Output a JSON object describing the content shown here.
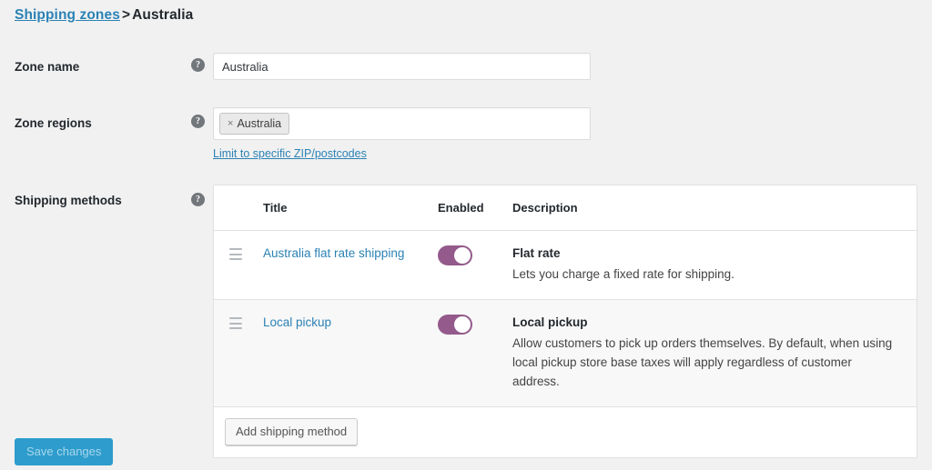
{
  "breadcrumb": {
    "parent_link": "Shipping zones",
    "separator": ">",
    "current": "Australia"
  },
  "form": {
    "zone_name": {
      "label": "Zone name",
      "help_icon": "help-circle-icon",
      "value": "Australia",
      "placeholder": "Zone name"
    },
    "zone_regions": {
      "label": "Zone regions",
      "help_icon": "help-circle-icon",
      "chips": [
        {
          "remove_glyph": "×",
          "label": "Australia"
        }
      ],
      "postcode_link": "Limit to specific ZIP/postcodes"
    },
    "shipping_methods": {
      "label": "Shipping methods",
      "help_icon": "help-circle-icon"
    }
  },
  "methods_table": {
    "columns": {
      "handle": "",
      "title": "Title",
      "enabled": "Enabled",
      "description": "Description"
    },
    "rows": [
      {
        "handle_icon": "drag-handle-icon",
        "title": "Australia flat rate shipping",
        "enabled": true,
        "toggle_state": "on",
        "desc_title": "Flat rate",
        "desc_text": "Lets you charge a fixed rate for shipping."
      },
      {
        "handle_icon": "drag-handle-icon",
        "title": "Local pickup",
        "enabled": true,
        "toggle_state": "on",
        "desc_title": "Local pickup",
        "desc_text": "Allow customers to pick up orders themselves. By default, when using local pickup store base taxes will apply regardless of customer address."
      }
    ],
    "add_button": "Add shipping method"
  },
  "footer": {
    "save_button": "Save changes"
  },
  "colors": {
    "link": "#2b82b5",
    "toggle_on": "#935a8b",
    "primary_button": "#2e9ccc",
    "primary_button_text": "#a7d7ec",
    "page_background": "#f1f1f1",
    "panel_background": "#ffffff",
    "row_alt_background": "#f8f8f8",
    "border": "#e1e1e1"
  }
}
